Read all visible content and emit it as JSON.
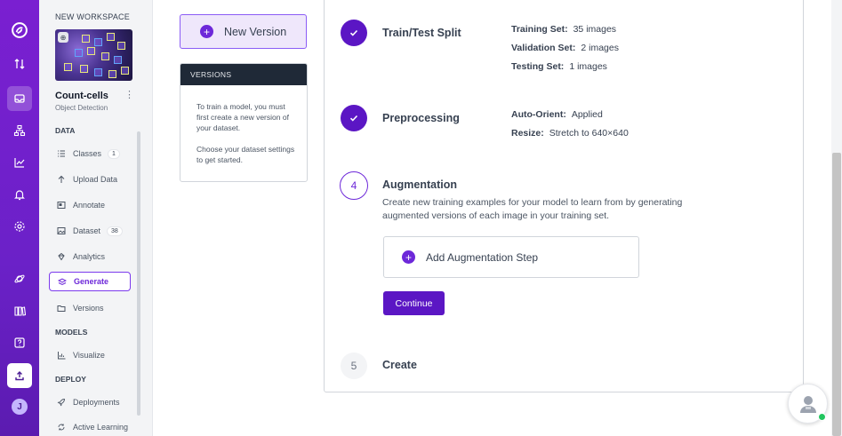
{
  "workspace": {
    "label": "NEW WORKSPACE"
  },
  "project": {
    "name": "Count-cells",
    "type": "Object Detection",
    "thumb_badge": "⊕"
  },
  "sidebar": {
    "sections": {
      "data": "DATA",
      "models": "MODELS",
      "deploy": "DEPLOY"
    },
    "items": [
      {
        "label": "Classes",
        "count": "1",
        "icon": "list-icon"
      },
      {
        "label": "Upload Data",
        "icon": "arrow-up-icon"
      },
      {
        "label": "Annotate",
        "icon": "annotate-icon"
      },
      {
        "label": "Dataset",
        "count": "38",
        "icon": "image-icon"
      },
      {
        "label": "Analytics",
        "icon": "diamond-icon"
      },
      {
        "label": "Generate",
        "icon": "layers-icon",
        "active": true
      },
      {
        "label": "Versions",
        "icon": "folder-icon"
      },
      {
        "label": "Visualize",
        "icon": "chart-icon"
      },
      {
        "label": "Deployments",
        "icon": "rocket-icon"
      },
      {
        "label": "Active Learning",
        "icon": "loop-icon"
      }
    ]
  },
  "rail": {
    "avatar_initial": "J"
  },
  "main": {
    "new_version_label": "New Version",
    "versions": {
      "header": "VERSIONS",
      "body_1": "To train a model, you must first create a new version of your dataset.",
      "body_2": "Choose your dataset settings to get started."
    },
    "steps": {
      "split": {
        "title": "Train/Test Split",
        "training_key": "Training Set:",
        "training_val": "35 images",
        "validation_key": "Validation Set:",
        "validation_val": "2 images",
        "testing_key": "Testing Set:",
        "testing_val": "1 images"
      },
      "preprocessing": {
        "title": "Preprocessing",
        "orient_key": "Auto-Orient:",
        "orient_val": "Applied",
        "resize_key": "Resize:",
        "resize_val": "Stretch to 640×640"
      },
      "augmentation": {
        "number": "4",
        "title": "Augmentation",
        "description": "Create new training examples for your model to learn from by generating augmented versions of each image in your training set.",
        "add_step_label": "Add Augmentation Step",
        "continue_label": "Continue"
      },
      "create": {
        "number": "5",
        "title": "Create"
      }
    }
  },
  "colors": {
    "accent": "#5b16c4",
    "rail": "#7a1fd1",
    "success": "#22c55e"
  }
}
